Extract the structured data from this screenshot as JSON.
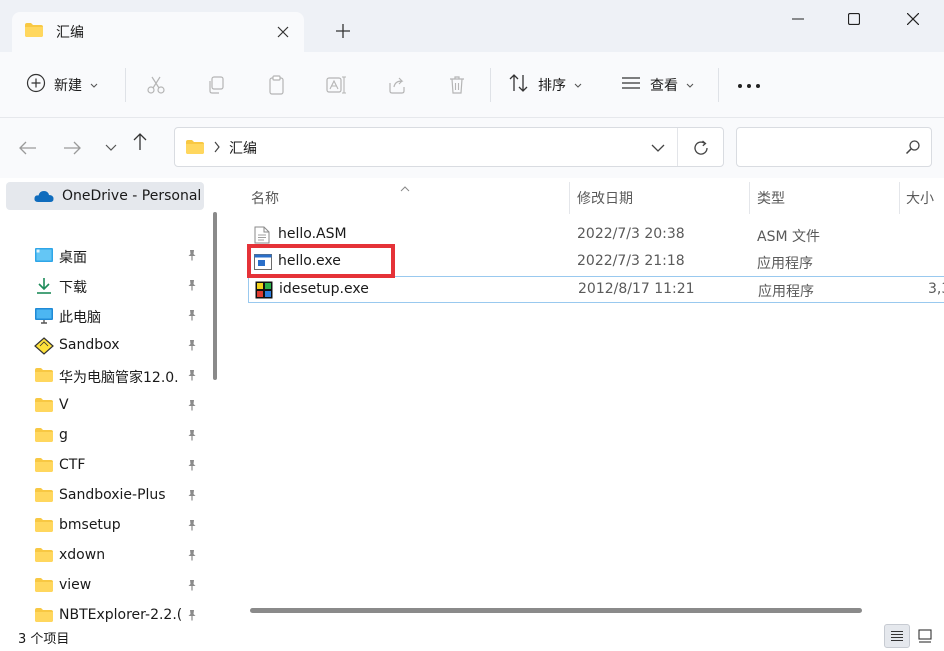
{
  "window": {
    "tab_title": "汇编",
    "new_tab_symbol": "+"
  },
  "toolbar": {
    "new_label": "新建",
    "sort_label": "排序",
    "view_label": "查看",
    "more_symbol": "···"
  },
  "address": {
    "path": "汇编",
    "search_placeholder": ""
  },
  "sidebar": {
    "onedrive_label": "OneDrive - Personal",
    "items": [
      {
        "label": "桌面",
        "icon": "desktop-icon"
      },
      {
        "label": "下载",
        "icon": "download-icon"
      },
      {
        "label": "此电脑",
        "icon": "computer-icon"
      },
      {
        "label": "Sandbox",
        "icon": "sandbox-icon"
      },
      {
        "label": "华为电脑管家12.0.",
        "icon": "folder-icon"
      },
      {
        "label": "V",
        "icon": "folder-icon"
      },
      {
        "label": "g",
        "icon": "folder-icon"
      },
      {
        "label": "CTF",
        "icon": "folder-icon"
      },
      {
        "label": "Sandboxie-Plus",
        "icon": "folder-icon"
      },
      {
        "label": "bmsetup",
        "icon": "folder-icon"
      },
      {
        "label": "xdown",
        "icon": "folder-icon"
      },
      {
        "label": "view",
        "icon": "folder-icon"
      },
      {
        "label": "NBTExplorer-2.2.(",
        "icon": "folder-icon"
      }
    ]
  },
  "columns": {
    "name": "名称",
    "modified": "修改日期",
    "type": "类型",
    "size": "大小"
  },
  "files": [
    {
      "name": "hello.ASM",
      "modified": "2022/7/3 20:38",
      "type": "ASM 文件",
      "size": "",
      "icon": "text-file-icon"
    },
    {
      "name": "hello.exe",
      "modified": "2022/7/3 21:18",
      "type": "应用程序",
      "size": "",
      "icon": "exe-file-icon"
    },
    {
      "name": "idesetup.exe",
      "modified": "2012/8/17 11:21",
      "type": "应用程序",
      "size": "3,3",
      "icon": "setup-exe-icon"
    }
  ],
  "status": {
    "item_count": "3 个项目"
  },
  "colors": {
    "folder": "#f8c843",
    "highlight_box": "#e53238",
    "selection_border": "#99c9ef",
    "onedrive": "#0f6cbd"
  }
}
